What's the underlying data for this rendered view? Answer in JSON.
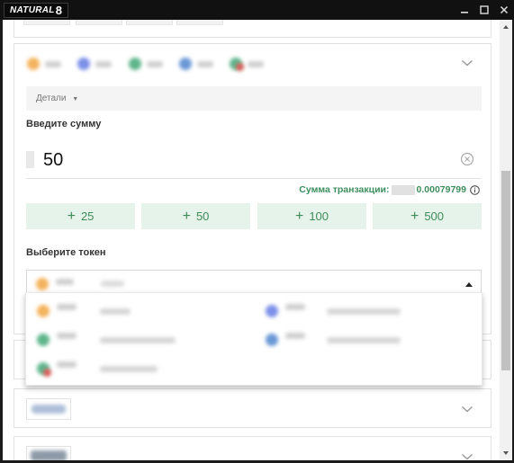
{
  "window": {
    "logo_small": "NATURAL",
    "logo_big": "8"
  },
  "deposit": {
    "details_label": "Детали",
    "enter_amount_label": "Введите сумму",
    "amount_value": "50",
    "tx_sum_label": "Сумма транзакции:",
    "tx_sum_value": "0.00079799",
    "quick_amounts": [
      "25",
      "50",
      "100",
      "500"
    ],
    "choose_token_label": "Выберите токен"
  },
  "colors": {
    "accent_green": "#3e8e5e",
    "quick_button_bg": "#e6f3ea",
    "titlebar_bg": "#111111"
  },
  "icons": [
    "minimize-icon",
    "maximize-icon",
    "close-icon",
    "chevron-down-icon",
    "clear-icon",
    "info-icon",
    "caret-up-icon"
  ]
}
